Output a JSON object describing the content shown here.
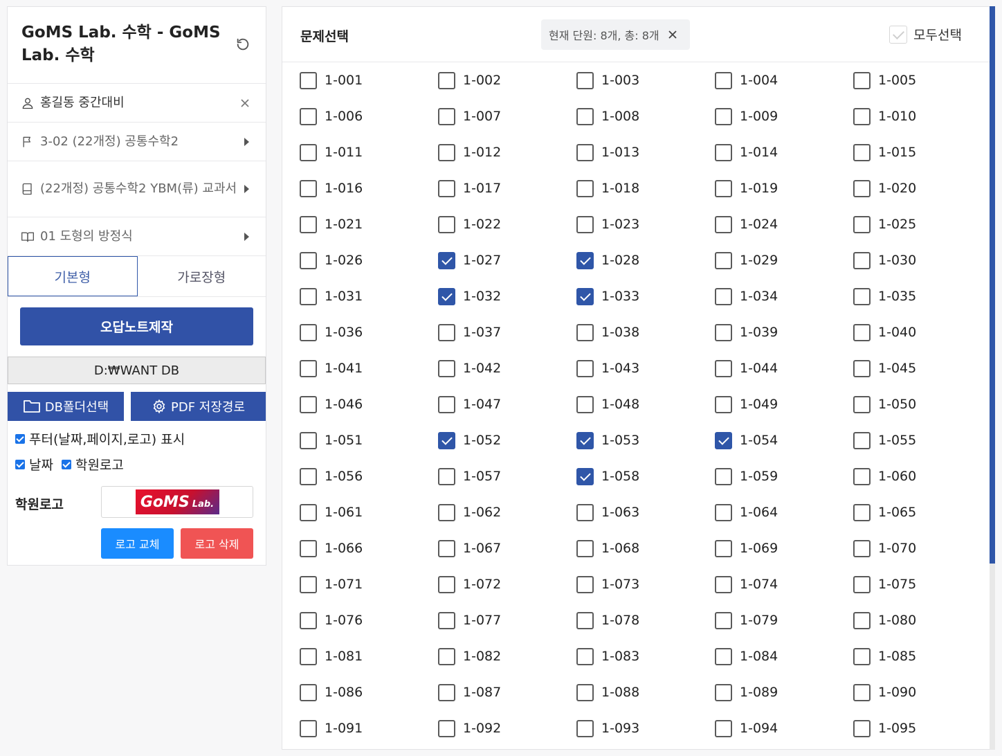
{
  "sidebar": {
    "title": "GoMS Lab. 수학 - GoMS Lab. 수학",
    "student": "홍길동 중간대비",
    "course": "3-02 (22개정) 공통수학2",
    "book": "(22개정) 공통수학2 YBM(류) 교과서",
    "unit": "01 도형의 방정식",
    "tabs": [
      "기본형",
      "가로장형"
    ],
    "create_button": "오답노트제작",
    "db_path": "D:₩WANT DB",
    "db_folder_button": "DB폴더선택",
    "pdf_path_button": "PDF 저장경로",
    "footer_option": "푸터(날짜,페이지,로고) 표시",
    "date_option": "날짜",
    "logo_option": "학원로고",
    "logo_label": "학원로고",
    "logo_text_big": "GoMS",
    "logo_text_small": "Lab.",
    "logo_replace_button": "로고 교체",
    "logo_delete_button": "로고 삭제"
  },
  "main": {
    "title": "문제선택",
    "filter_tag": "현재 단원: 8개, 총: 8개",
    "select_all_label": "모두선택"
  },
  "problems": [
    {
      "label": "1-001",
      "checked": false
    },
    {
      "label": "1-002",
      "checked": false
    },
    {
      "label": "1-003",
      "checked": false
    },
    {
      "label": "1-004",
      "checked": false
    },
    {
      "label": "1-005",
      "checked": false
    },
    {
      "label": "1-006",
      "checked": false
    },
    {
      "label": "1-007",
      "checked": false
    },
    {
      "label": "1-008",
      "checked": false
    },
    {
      "label": "1-009",
      "checked": false
    },
    {
      "label": "1-010",
      "checked": false
    },
    {
      "label": "1-011",
      "checked": false
    },
    {
      "label": "1-012",
      "checked": false
    },
    {
      "label": "1-013",
      "checked": false
    },
    {
      "label": "1-014",
      "checked": false
    },
    {
      "label": "1-015",
      "checked": false
    },
    {
      "label": "1-016",
      "checked": false
    },
    {
      "label": "1-017",
      "checked": false
    },
    {
      "label": "1-018",
      "checked": false
    },
    {
      "label": "1-019",
      "checked": false
    },
    {
      "label": "1-020",
      "checked": false
    },
    {
      "label": "1-021",
      "checked": false
    },
    {
      "label": "1-022",
      "checked": false
    },
    {
      "label": "1-023",
      "checked": false
    },
    {
      "label": "1-024",
      "checked": false
    },
    {
      "label": "1-025",
      "checked": false
    },
    {
      "label": "1-026",
      "checked": false
    },
    {
      "label": "1-027",
      "checked": true
    },
    {
      "label": "1-028",
      "checked": true
    },
    {
      "label": "1-029",
      "checked": false
    },
    {
      "label": "1-030",
      "checked": false
    },
    {
      "label": "1-031",
      "checked": false
    },
    {
      "label": "1-032",
      "checked": true
    },
    {
      "label": "1-033",
      "checked": true
    },
    {
      "label": "1-034",
      "checked": false
    },
    {
      "label": "1-035",
      "checked": false
    },
    {
      "label": "1-036",
      "checked": false
    },
    {
      "label": "1-037",
      "checked": false
    },
    {
      "label": "1-038",
      "checked": false
    },
    {
      "label": "1-039",
      "checked": false
    },
    {
      "label": "1-040",
      "checked": false
    },
    {
      "label": "1-041",
      "checked": false
    },
    {
      "label": "1-042",
      "checked": false
    },
    {
      "label": "1-043",
      "checked": false
    },
    {
      "label": "1-044",
      "checked": false
    },
    {
      "label": "1-045",
      "checked": false
    },
    {
      "label": "1-046",
      "checked": false
    },
    {
      "label": "1-047",
      "checked": false
    },
    {
      "label": "1-048",
      "checked": false
    },
    {
      "label": "1-049",
      "checked": false
    },
    {
      "label": "1-050",
      "checked": false
    },
    {
      "label": "1-051",
      "checked": false
    },
    {
      "label": "1-052",
      "checked": true
    },
    {
      "label": "1-053",
      "checked": true
    },
    {
      "label": "1-054",
      "checked": true
    },
    {
      "label": "1-055",
      "checked": false
    },
    {
      "label": "1-056",
      "checked": false
    },
    {
      "label": "1-057",
      "checked": false
    },
    {
      "label": "1-058",
      "checked": true
    },
    {
      "label": "1-059",
      "checked": false
    },
    {
      "label": "1-060",
      "checked": false
    },
    {
      "label": "1-061",
      "checked": false
    },
    {
      "label": "1-062",
      "checked": false
    },
    {
      "label": "1-063",
      "checked": false
    },
    {
      "label": "1-064",
      "checked": false
    },
    {
      "label": "1-065",
      "checked": false
    },
    {
      "label": "1-066",
      "checked": false
    },
    {
      "label": "1-067",
      "checked": false
    },
    {
      "label": "1-068",
      "checked": false
    },
    {
      "label": "1-069",
      "checked": false
    },
    {
      "label": "1-070",
      "checked": false
    },
    {
      "label": "1-071",
      "checked": false
    },
    {
      "label": "1-072",
      "checked": false
    },
    {
      "label": "1-073",
      "checked": false
    },
    {
      "label": "1-074",
      "checked": false
    },
    {
      "label": "1-075",
      "checked": false
    },
    {
      "label": "1-076",
      "checked": false
    },
    {
      "label": "1-077",
      "checked": false
    },
    {
      "label": "1-078",
      "checked": false
    },
    {
      "label": "1-079",
      "checked": false
    },
    {
      "label": "1-080",
      "checked": false
    },
    {
      "label": "1-081",
      "checked": false
    },
    {
      "label": "1-082",
      "checked": false
    },
    {
      "label": "1-083",
      "checked": false
    },
    {
      "label": "1-084",
      "checked": false
    },
    {
      "label": "1-085",
      "checked": false
    },
    {
      "label": "1-086",
      "checked": false
    },
    {
      "label": "1-087",
      "checked": false
    },
    {
      "label": "1-088",
      "checked": false
    },
    {
      "label": "1-089",
      "checked": false
    },
    {
      "label": "1-090",
      "checked": false
    },
    {
      "label": "1-091",
      "checked": false
    },
    {
      "label": "1-092",
      "checked": false
    },
    {
      "label": "1-093",
      "checked": false
    },
    {
      "label": "1-094",
      "checked": false
    },
    {
      "label": "1-095",
      "checked": false
    }
  ],
  "colors": {
    "primary": "#3152a7",
    "checkbox_checked": "#2f56a8",
    "logo_replace": "#1a8cff",
    "logo_delete": "#f05454"
  },
  "icons": {
    "refresh": "refresh-icon",
    "user": "user-icon",
    "close": "close-icon",
    "flag": "flag-icon",
    "book": "book-icon",
    "open_book": "open-book-icon",
    "folder": "folder-icon",
    "gear": "gear-icon"
  }
}
